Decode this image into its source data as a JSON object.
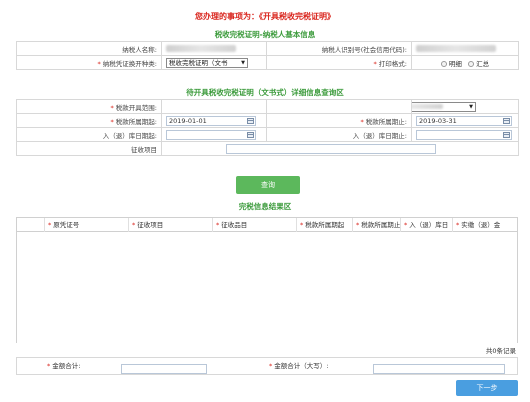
{
  "header": {
    "title": "您办理的事项为：《开具税收完税证明》"
  },
  "section_basic": {
    "title": "税收完税证明-纳税人基本信息",
    "taxpayer_name_label": "纳税人名称:",
    "taxpayer_id_label": "纳税人识别号(社会信用代码):",
    "cert_type_label": "纳税凭证换开种类:",
    "cert_type_value": "税收完税证明（文书",
    "print_format_label": "打印格式:",
    "print_options": [
      "明细",
      "汇总"
    ]
  },
  "section_query": {
    "title": "待开具税收完税证明（文书式）详细信息查询区",
    "tax_office_label": "税款开具范围:",
    "period_start_label": "税款所属期起:",
    "period_start_value": "2019-01-01",
    "period_end_label": "税款所属期止:",
    "period_end_value": "2019-03-31",
    "entry_start_label": "入（退）库日期起:",
    "entry_end_label": "入（退）库日期止:",
    "levy_item_label": "征收项目",
    "query_button": "查询"
  },
  "section_result": {
    "title": "完税信息结果区",
    "columns": [
      "原凭证号",
      "征收项目",
      "征收品目",
      "税款所属期起",
      "税款所属期止",
      "入（退）库日",
      "实缴（退）金"
    ],
    "record_count": "共0条记录"
  },
  "totals": {
    "amount_label": "金额合计:",
    "amount_upper_label": "金额合计（大写）:"
  },
  "actions": {
    "next_button": "下一步"
  }
}
